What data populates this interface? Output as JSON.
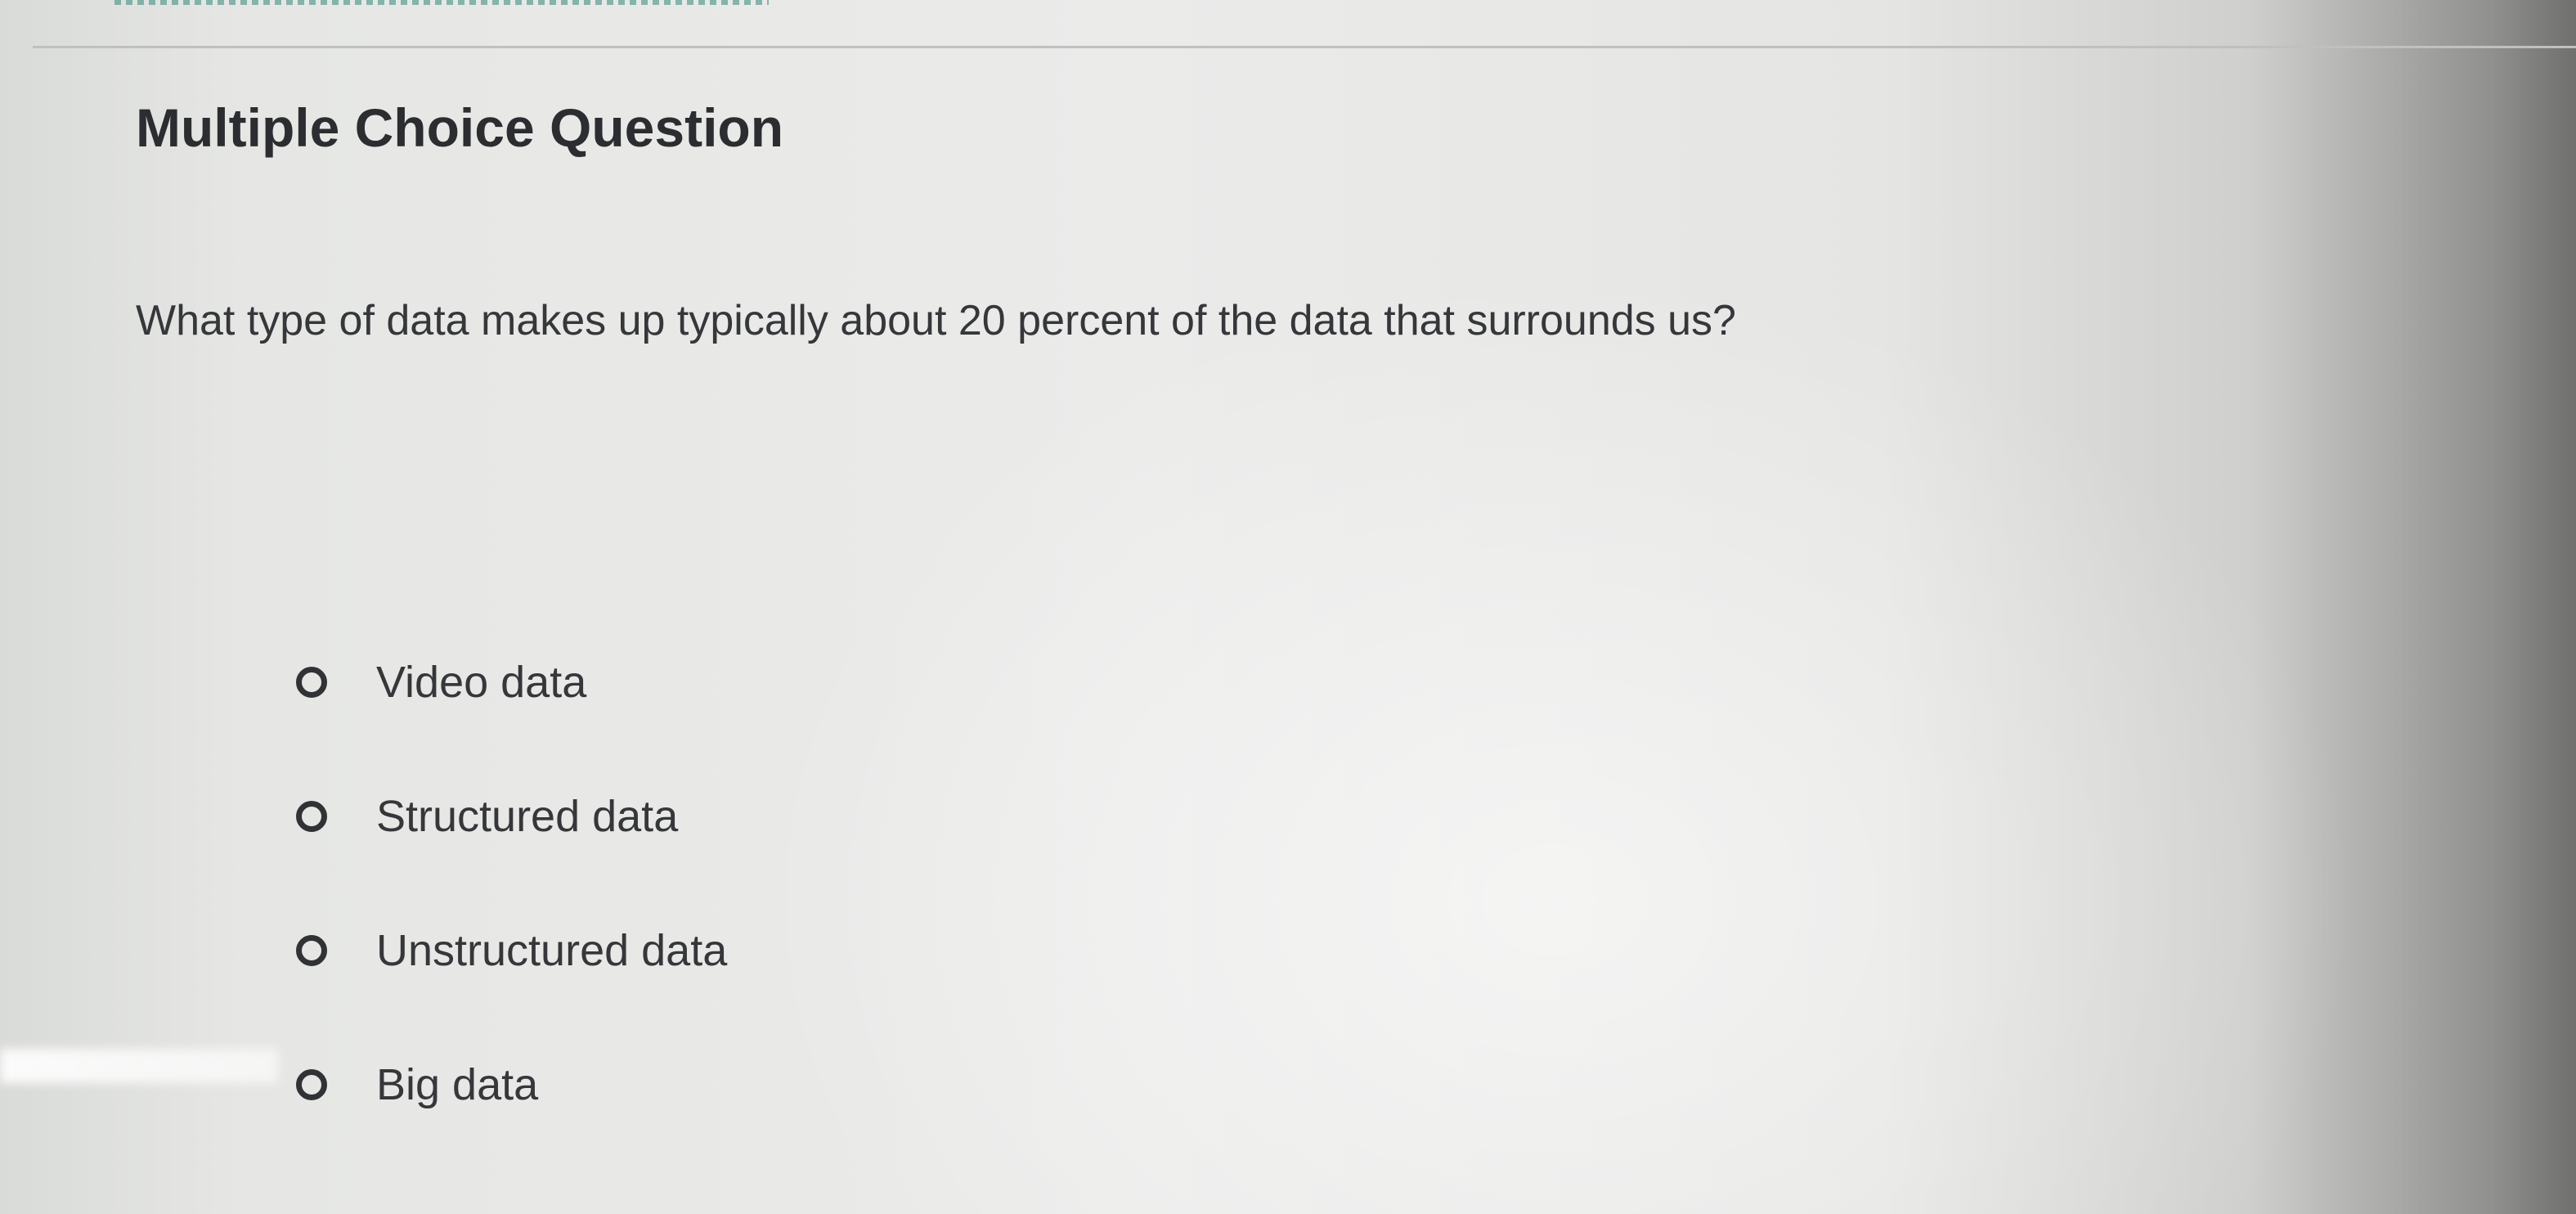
{
  "question": {
    "title": "Multiple Choice Question",
    "text": "What type of data makes up typically about 20 percent of the data that surrounds us?"
  },
  "options": [
    {
      "label": "Video data",
      "selected": false
    },
    {
      "label": "Structured data",
      "selected": false
    },
    {
      "label": "Unstructured data",
      "selected": false
    },
    {
      "label": "Big data",
      "selected": false
    }
  ],
  "colors": {
    "text": "#35373a",
    "title": "#2b2d30",
    "radio_border": "#303235",
    "accent_dots": "#2f8a7c"
  }
}
